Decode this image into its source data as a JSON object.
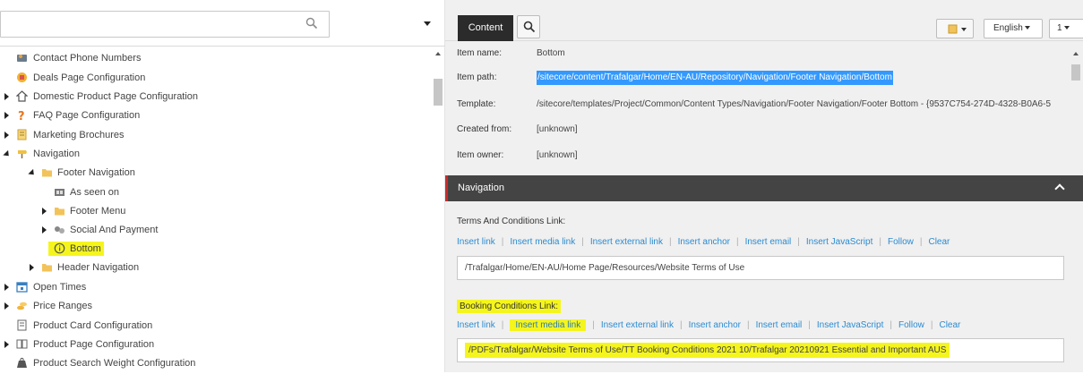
{
  "colors": {
    "highlight": "#f5f51e",
    "selection": "#3399ff",
    "link": "#2b8bd0",
    "section_bar": "#444444",
    "section_accent": "#c62d2d",
    "active_tab": "#2b2b2b"
  },
  "tree": {
    "search_placeholder": "",
    "items": [
      {
        "label": "Contact Phone Numbers",
        "icon": "phone-book-icon",
        "expander": "none"
      },
      {
        "label": "Deals Page Configuration",
        "icon": "deals-icon",
        "expander": "none"
      },
      {
        "label": "Domestic Product Page Configuration",
        "icon": "house-icon",
        "expander": "collapsed"
      },
      {
        "label": "FAQ Page Configuration",
        "icon": "question-icon",
        "expander": "collapsed"
      },
      {
        "label": "Marketing Brochures",
        "icon": "document-icon",
        "expander": "collapsed"
      },
      {
        "label": "Navigation",
        "icon": "navigation-icon",
        "expander": "expanded"
      },
      {
        "label": "Footer Navigation",
        "icon": "folder-icon",
        "expander": "expanded"
      },
      {
        "label": "As seen on",
        "icon": "media-icon",
        "expander": "none"
      },
      {
        "label": "Footer Menu",
        "icon": "folder-icon",
        "expander": "collapsed"
      },
      {
        "label": "Social And Payment",
        "icon": "social-icon",
        "expander": "collapsed"
      },
      {
        "label": "Bottom",
        "icon": "info-icon",
        "expander": "none"
      },
      {
        "label": "Header Navigation",
        "icon": "folder-icon",
        "expander": "collapsed"
      },
      {
        "label": "Open Times",
        "icon": "calendar-icon",
        "expander": "collapsed"
      },
      {
        "label": "Price Ranges",
        "icon": "coins-icon",
        "expander": "collapsed"
      },
      {
        "label": "Product Card Configuration",
        "icon": "card-icon",
        "expander": "none"
      },
      {
        "label": "Product Page Configuration",
        "icon": "pages-icon",
        "expander": "collapsed"
      },
      {
        "label": "Product Search Weight Configuration",
        "icon": "weight-icon",
        "expander": "none"
      }
    ]
  },
  "toolbar": {
    "content_tab": "Content",
    "language": "English",
    "version": "1"
  },
  "item_info": {
    "name_label": "Item name:",
    "name_value": "Bottom",
    "path_label": "Item path:",
    "path_value": "/sitecore/content/Trafalgar/Home/EN-AU/Repository/Navigation/Footer Navigation/Bottom",
    "template_label": "Template:",
    "template_value": "/sitecore/templates/Project/Common/Content Types/Navigation/Footer Navigation/Footer Bottom - {9537C754-274D-4328-B0A6-5",
    "created_label": "Created from:",
    "created_value": "[unknown]",
    "owner_label": "Item owner:",
    "owner_value": "[unknown]"
  },
  "section": {
    "title": "Navigation",
    "fields": [
      {
        "label": "Terms And Conditions Link:",
        "value": "/Trafalgar/Home/EN-AU/Home Page/Resources/Website Terms of Use"
      },
      {
        "label": "Booking Conditions Link:",
        "value": "/PDFs/Trafalgar/Website Terms of Use/TT Booking Conditions 2021 10/Trafalgar 20210921  Essential and Important AUS"
      }
    ],
    "links": [
      "Insert link",
      "Insert media link",
      "Insert external link",
      "Insert anchor",
      "Insert email",
      "Insert JavaScript",
      "Follow",
      "Clear"
    ]
  }
}
